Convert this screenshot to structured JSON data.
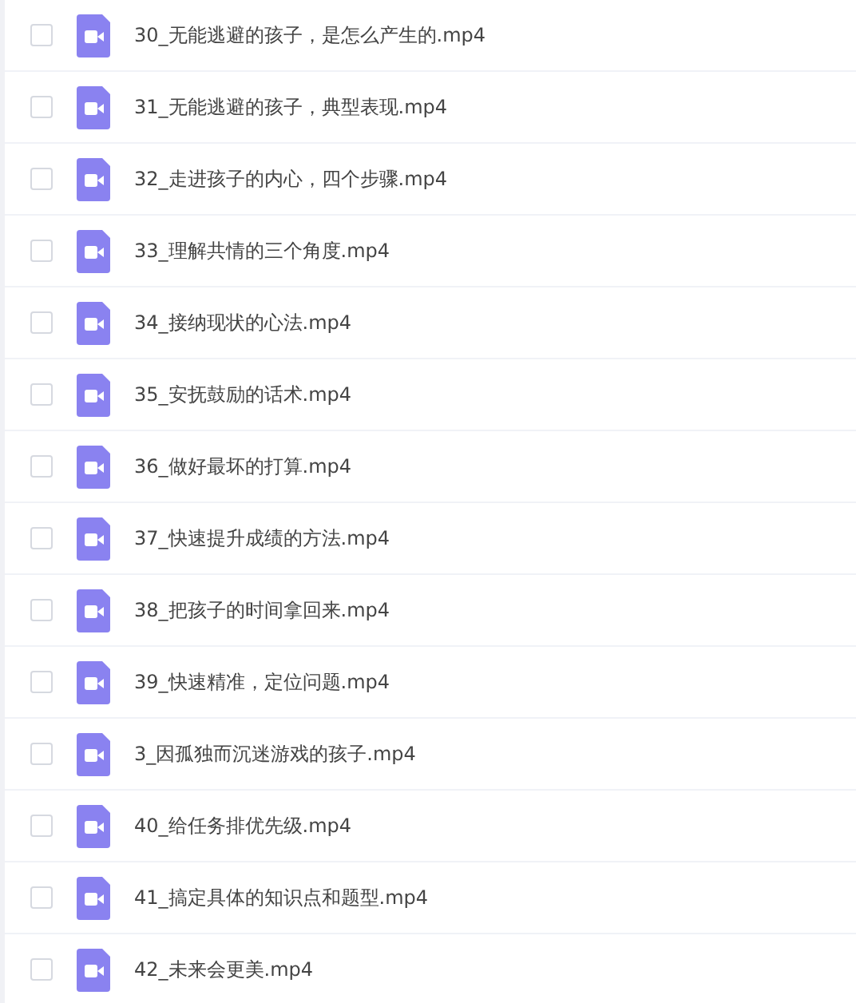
{
  "files": [
    {
      "name": "30_无能逃避的孩子，是怎么产生的.mp4",
      "checked": false
    },
    {
      "name": "31_无能逃避的孩子，典型表现.mp4",
      "checked": false
    },
    {
      "name": "32_走进孩子的内心，四个步骤.mp4",
      "checked": false
    },
    {
      "name": "33_理解共情的三个角度.mp4",
      "checked": false
    },
    {
      "name": "34_接纳现状的心法.mp4",
      "checked": false
    },
    {
      "name": "35_安抚鼓励的话术.mp4",
      "checked": false
    },
    {
      "name": "36_做好最坏的打算.mp4",
      "checked": false
    },
    {
      "name": "37_快速提升成绩的方法.mp4",
      "checked": false
    },
    {
      "name": "38_把孩子的时间拿回来.mp4",
      "checked": false
    },
    {
      "name": "39_快速精准，定位问题.mp4",
      "checked": false
    },
    {
      "name": "3_因孤独而沉迷游戏的孩子.mp4",
      "checked": false
    },
    {
      "name": "40_给任务排优先级.mp4",
      "checked": false
    },
    {
      "name": "41_搞定具体的知识点和题型.mp4",
      "checked": false
    },
    {
      "name": "42_未来会更美.mp4",
      "checked": false
    }
  ]
}
